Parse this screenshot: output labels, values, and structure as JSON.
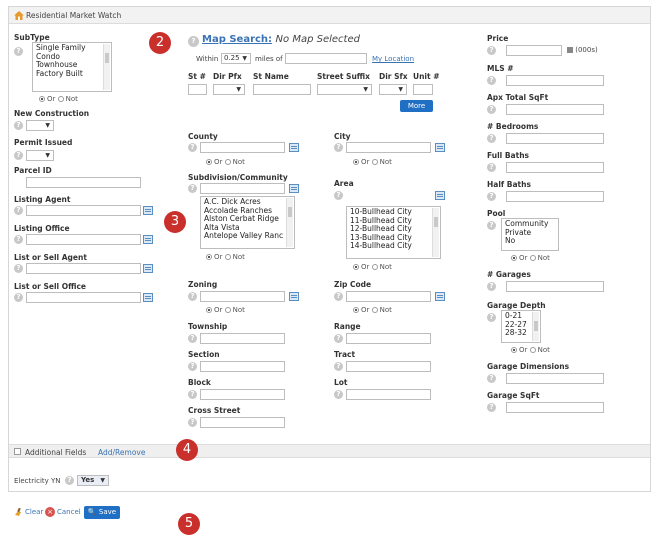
{
  "window": {
    "title": "Residential Market Watch"
  },
  "left": {
    "subtype": {
      "label": "SubType",
      "options": [
        "Single Family",
        "Condo",
        "Townhouse",
        "Factory Built"
      ]
    },
    "new_construction": {
      "label": "New Construction"
    },
    "permit_issued": {
      "label": "Permit Issued"
    },
    "parcel_id": {
      "label": "Parcel ID"
    },
    "listing_agent": {
      "label": "Listing Agent"
    },
    "listing_office": {
      "label": "Listing Office"
    },
    "list_or_sell_agent": {
      "label": "List or Sell Agent"
    },
    "list_or_sell_office": {
      "label": "List or Sell Office"
    }
  },
  "or_not": {
    "or": "Or",
    "not": "Not"
  },
  "map": {
    "link": "Map Search:",
    "status": "No Map Selected",
    "within": "Within",
    "radius": "0.25",
    "miles_of": "miles of",
    "my_location": "My Location",
    "more": "More"
  },
  "address": {
    "st_num": "St #",
    "dir_pfx": "Dir Pfx",
    "st_name": "St Name",
    "st_suffix": "Street Suffix",
    "dir_sfx": "Dir Sfx",
    "unit": "Unit #"
  },
  "middle": {
    "county": "County",
    "city": "City",
    "subdivision": {
      "label": "Subdivision/Community",
      "options": [
        "A.C. Dick Acres",
        "Accolade Ranches",
        "Alston Cerbat Ridge",
        "Alta Vista",
        "Antelope Valley Ranc"
      ]
    },
    "area": {
      "label": "Area",
      "options": [
        "10-Bullhead City",
        "11-Bullhead City",
        "12-Bullhead City",
        "13-Bullhead City",
        "14-Bullhead City"
      ]
    },
    "zoning": "Zoning",
    "zip_code": "Zip Code",
    "township": "Township",
    "range": "Range",
    "section": "Section",
    "tract": "Tract",
    "block": "Block",
    "lot": "Lot",
    "cross_street": "Cross Street"
  },
  "right": {
    "price": {
      "label": "Price",
      "unit": "(000s)"
    },
    "mls": "MLS #",
    "apx_total_sqft": "Apx Total SqFt",
    "bedrooms": "# Bedrooms",
    "full_baths": "Full Baths",
    "half_baths": "Half Baths",
    "pool": {
      "label": "Pool",
      "options": [
        "Community",
        "Private",
        "No"
      ]
    },
    "garages": "# Garages",
    "garage_depth": {
      "label": "Garage Depth",
      "options": [
        "0-21",
        "22-27",
        "28-32"
      ]
    },
    "garage_dimensions": "Garage Dimensions",
    "garage_sqft": "Garage SqFt"
  },
  "additional": {
    "label": "Additional Fields",
    "link": "Add/Remove"
  },
  "electricity": {
    "label": "Electricity YN",
    "value": "Yes"
  },
  "actions": {
    "clear": "Clear",
    "cancel": "Cancel",
    "save": "Save"
  },
  "badges": {
    "b2": "2",
    "b3": "3",
    "b4": "4",
    "b5": "5"
  },
  "colors": {
    "accent": "#1f6fc5",
    "badge": "#c9302c",
    "link": "#3a73b5"
  }
}
